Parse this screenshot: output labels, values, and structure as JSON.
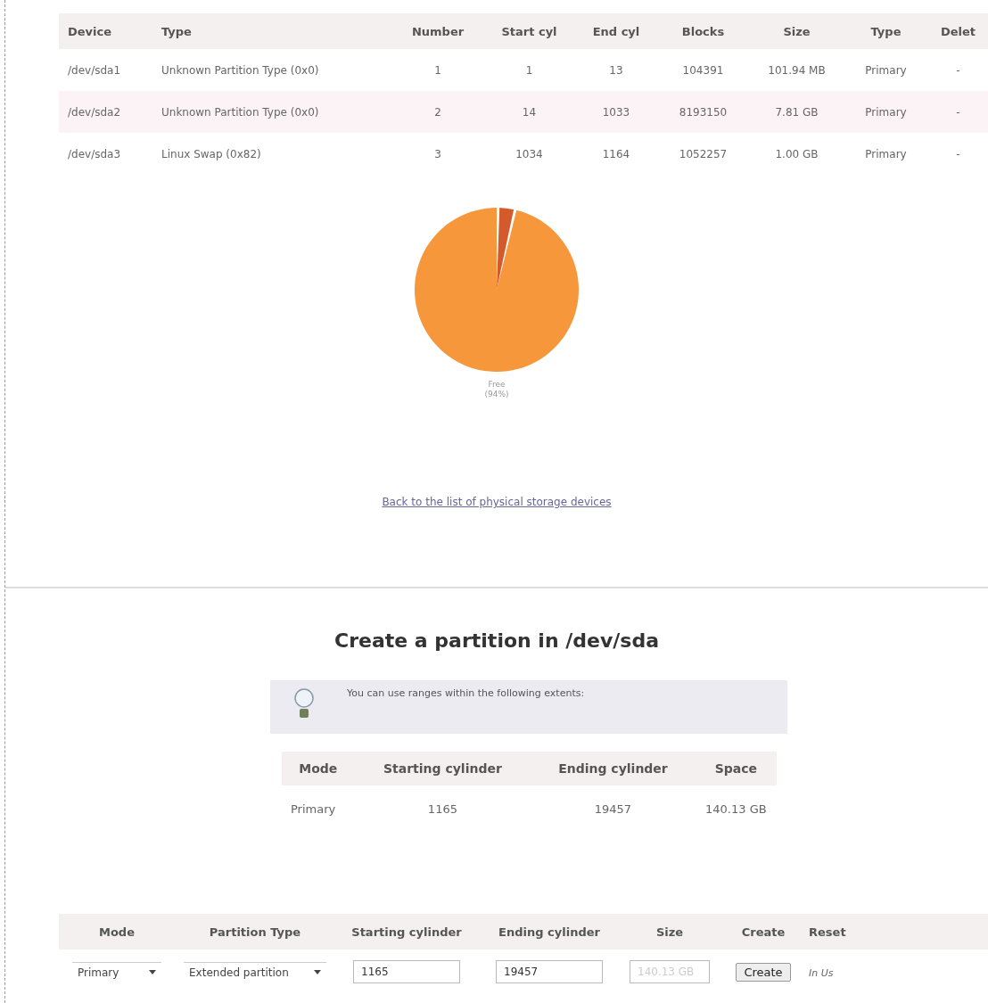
{
  "partitions_table": {
    "columns": [
      "Device",
      "Type",
      "Number",
      "Start cyl",
      "End cyl",
      "Blocks",
      "Size",
      "Type",
      "Delet"
    ],
    "rows": [
      {
        "cells": [
          "/dev/sda1",
          "Unknown Partition Type (0x0)",
          "1",
          "1",
          "13",
          "104391",
          "101.94 MB",
          "Primary",
          "-"
        ],
        "selected": false
      },
      {
        "cells": [
          "/dev/sda2",
          "Unknown Partition Type (0x0)",
          "2",
          "14",
          "1033",
          "8193150",
          "7.81 GB",
          "Primary",
          "-"
        ],
        "selected": true
      },
      {
        "cells": [
          "/dev/sda3",
          "Linux Swap (0x82)",
          "3",
          "1034",
          "1164",
          "1052257",
          "1.00 GB",
          "Primary",
          "-"
        ],
        "selected": false
      }
    ]
  },
  "pie": {
    "label": "Free",
    "percent": "(94%)"
  },
  "back_link": "Back to the list of physical storage devices",
  "create_section": {
    "title": "Create a partition in /dev/sda",
    "info": "You can use ranges within the following extents:",
    "extents_table": {
      "columns": [
        "Mode",
        "Starting cylinder",
        "Ending cylinder",
        "Space"
      ],
      "rows": [
        [
          "Primary",
          "1165",
          "19457",
          "140.13 GB"
        ]
      ]
    },
    "form": {
      "columns": [
        "Mode",
        "Partition Type",
        "Starting cylinder",
        "Ending cylinder",
        "Size",
        "Create",
        "Reset"
      ],
      "mode": "Primary",
      "partition_type": "Extended partition",
      "start": "1165",
      "end": "19457",
      "size": {
        "value": "140.13 GB",
        "disabled": true
      },
      "create_button": "Create",
      "reset": "In Us"
    }
  }
}
